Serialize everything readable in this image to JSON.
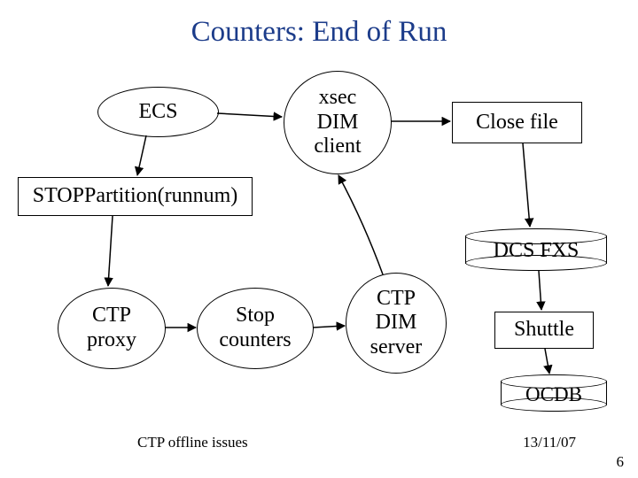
{
  "slide": {
    "title": "Counters: End of Run",
    "footer_left": "CTP offline issues",
    "footer_right": "13/11/07",
    "page_number": "6"
  },
  "nodes": {
    "ecs": {
      "label": "ECS"
    },
    "xsec": {
      "label": "xsec\nDIM\nclient"
    },
    "close_file": {
      "label": "Close file"
    },
    "stopp": {
      "label": "STOPPartition(runnum)"
    },
    "ctp_proxy": {
      "label": "CTP\nproxy"
    },
    "stop_cnt": {
      "label": "Stop\ncounters"
    },
    "ctp_dim": {
      "label": "CTP\nDIM\nserver"
    },
    "dcs_fxs": {
      "label": "DCS FXS"
    },
    "shuttle": {
      "label": "Shuttle"
    },
    "ocdb": {
      "label": "OCDB"
    }
  },
  "chart_data": {
    "type": "diagram",
    "title": "Counters: End of Run",
    "nodes": [
      {
        "id": "ecs",
        "label": "ECS",
        "shape": "ellipse"
      },
      {
        "id": "xsec",
        "label": "xsec DIM client",
        "shape": "ellipse"
      },
      {
        "id": "close_file",
        "label": "Close file",
        "shape": "rect"
      },
      {
        "id": "stopp",
        "label": "STOPPartition(runnum)",
        "shape": "rect"
      },
      {
        "id": "ctp_proxy",
        "label": "CTP proxy",
        "shape": "ellipse"
      },
      {
        "id": "stop_cnt",
        "label": "Stop counters",
        "shape": "ellipse"
      },
      {
        "id": "ctp_dim",
        "label": "CTP DIM server",
        "shape": "ellipse"
      },
      {
        "id": "dcs_fxs",
        "label": "DCS FXS",
        "shape": "cylinder"
      },
      {
        "id": "shuttle",
        "label": "Shuttle",
        "shape": "rect"
      },
      {
        "id": "ocdb",
        "label": "OCDB",
        "shape": "cylinder"
      }
    ],
    "edges": [
      {
        "from": "ecs",
        "to": "stopp"
      },
      {
        "from": "ecs",
        "to": "xsec"
      },
      {
        "from": "stopp",
        "to": "ctp_proxy"
      },
      {
        "from": "ctp_proxy",
        "to": "stop_cnt"
      },
      {
        "from": "stop_cnt",
        "to": "ctp_dim"
      },
      {
        "from": "ctp_dim",
        "to": "xsec"
      },
      {
        "from": "xsec",
        "to": "close_file"
      },
      {
        "from": "close_file",
        "to": "dcs_fxs"
      },
      {
        "from": "dcs_fxs",
        "to": "shuttle"
      },
      {
        "from": "shuttle",
        "to": "ocdb"
      }
    ]
  }
}
